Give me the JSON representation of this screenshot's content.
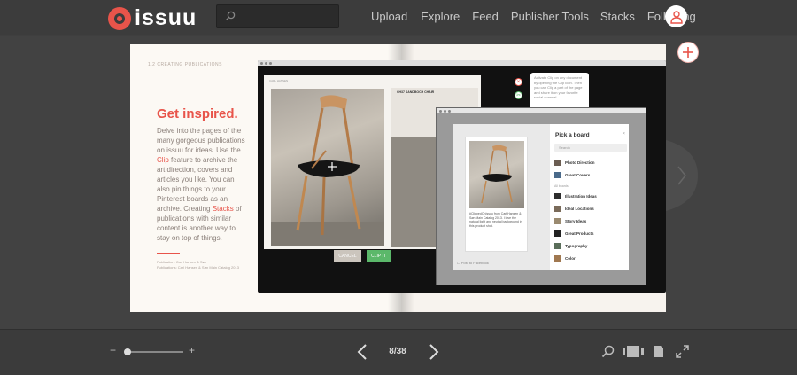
{
  "header": {
    "logo_text": "issuu",
    "search_placeholder": "",
    "nav": [
      "Upload",
      "Explore",
      "Feed",
      "Publisher Tools",
      "Stacks",
      "Following"
    ]
  },
  "publication": {
    "left_page": {
      "section_label": "1.2  CREATING PUBLICATIONS",
      "headline": "Get inspired.",
      "body_parts": [
        "Delve into the pages of the many gorgeous publications on issuu for ideas. Use the ",
        "Clip",
        " feature to archive the art direction, covers and articles you like. You can also pin things to your Pinterest boards as an archive. Creating ",
        "Stacks",
        " of publications with similar content is another way to stay on top of things."
      ],
      "credits": [
        "Publication: Carl Hansen & Søn",
        "Publications: Carl Hansen & Søn Main Catalog 2013"
      ]
    },
    "screen": {
      "magazine_title": "CARL HANSEN",
      "magazine_side_title": "CH37 SANDBOCH CHAIR",
      "cancel_label": "CANCEL",
      "clip_label": "CLIP IT",
      "tooltip_text": "Activate Clip on any document by opening the Clip icon. Then you can Clip a part of the page and share it on your favorite social channel."
    },
    "pinterest": {
      "title": "Pick a board",
      "close": "×",
      "search_placeholder": "Search",
      "card_text": "#ClippedOnIssuu from Carl Hansen & Søn Main Catalog 2013. I love the natural light and neutral background in this product shot.",
      "post_facebook": "Post to Facebook",
      "section_label": "All boards",
      "boards": [
        "Photo Direction",
        "Great Covers",
        "Illustration Ideas",
        "Ideal Locations",
        "Story Ideas",
        "Great Products",
        "Typography",
        "Color"
      ]
    }
  },
  "viewer": {
    "page_counter": "8/38",
    "zoom_minus": "−",
    "zoom_plus": "+",
    "zoom_level": 0.05
  },
  "colors": {
    "brand": "#e8544a",
    "clip_green": "#5bb86a",
    "background": "#424242"
  }
}
